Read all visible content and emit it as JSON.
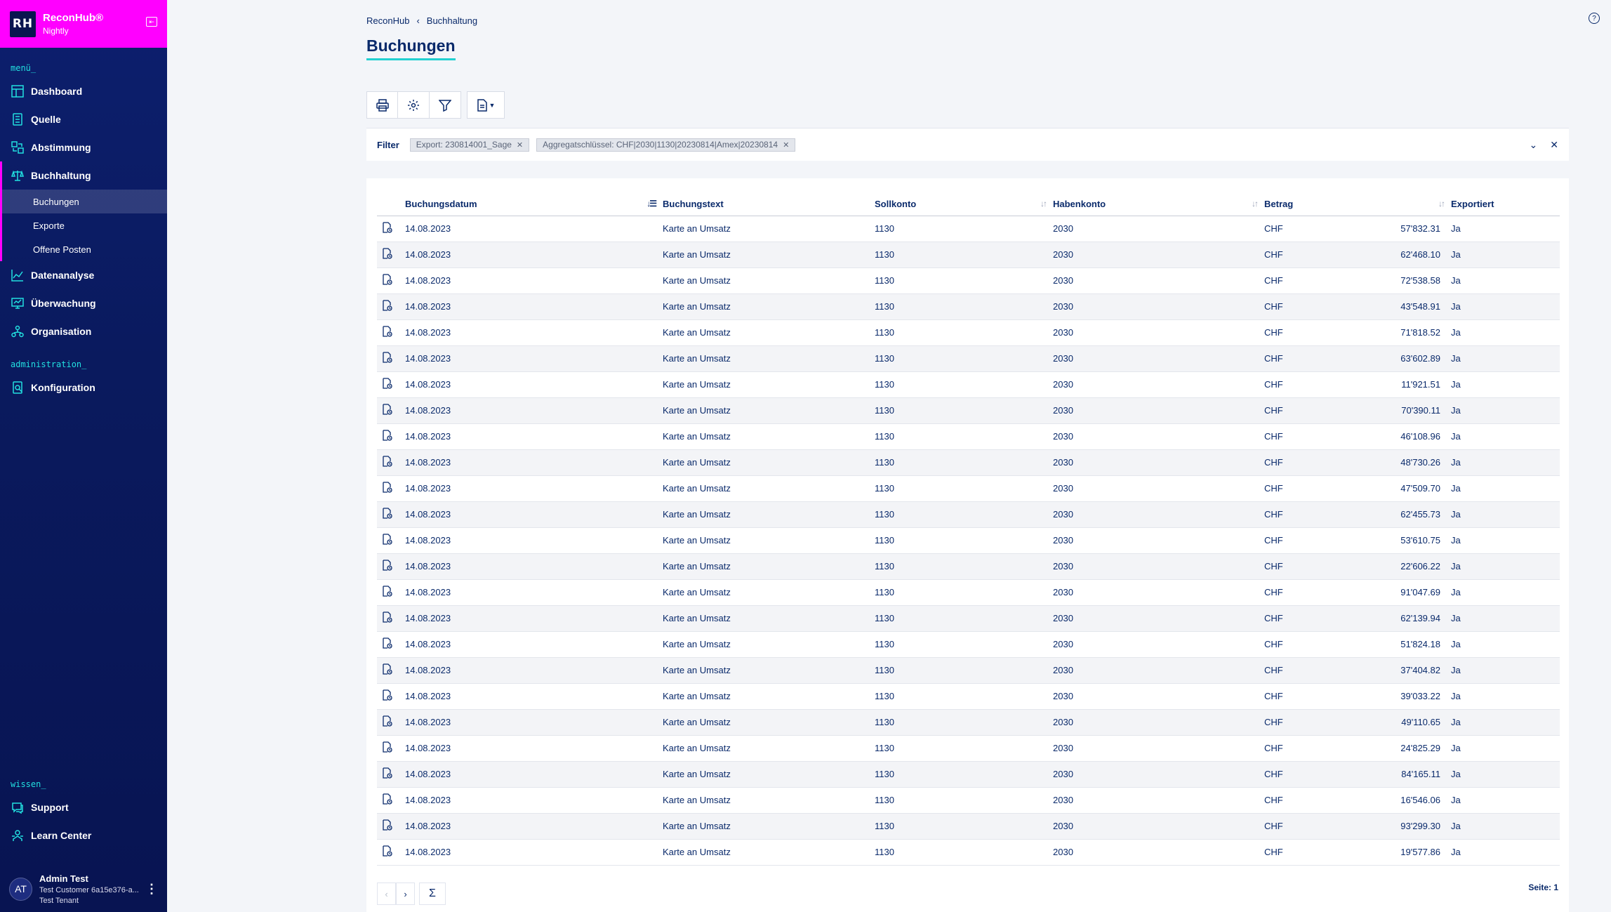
{
  "brand": {
    "logo": "RH",
    "name": "ReconHub®",
    "sub": "Nightly"
  },
  "sidebar": {
    "menu_label": "menü_",
    "items": [
      {
        "label": "Dashboard",
        "icon": "dashboard-icon"
      },
      {
        "label": "Quelle",
        "icon": "source-icon"
      },
      {
        "label": "Abstimmung",
        "icon": "reconcile-icon"
      },
      {
        "label": "Buchhaltung",
        "icon": "scale-icon"
      }
    ],
    "sub_items": [
      {
        "label": "Buchungen"
      },
      {
        "label": "Exporte"
      },
      {
        "label": "Offene Posten"
      }
    ],
    "items2": [
      {
        "label": "Datenanalyse",
        "icon": "chart-icon"
      },
      {
        "label": "Überwachung",
        "icon": "monitor-icon"
      },
      {
        "label": "Organisation",
        "icon": "org-icon"
      }
    ],
    "admin_label": "administration_",
    "admin_items": [
      {
        "label": "Konfiguration",
        "icon": "config-icon"
      }
    ],
    "wissen_label": "wissen_",
    "wissen_items": [
      {
        "label": "Support",
        "icon": "support-icon"
      },
      {
        "label": "Learn Center",
        "icon": "learn-icon"
      }
    ]
  },
  "user": {
    "initials": "AT",
    "name": "Admin Test",
    "customer": "Test Customer 6a15e376-a...",
    "tenant": "Test Tenant"
  },
  "header": {
    "breadcrumb_root": "ReconHub",
    "breadcrumb_current": "Buchhaltung",
    "title": "Buchungen"
  },
  "filter": {
    "label": "Filter",
    "chips": [
      "Export: 230814001_Sage",
      "Aggregatschlüssel: CHF|2030|1130|20230814|Amex|20230814"
    ]
  },
  "table": {
    "columns": [
      "Buchungsdatum",
      "Buchungstext",
      "Sollkonto",
      "Habenkonto",
      "Betrag",
      "Exportiert"
    ],
    "rows": [
      [
        "14.08.2023",
        "Karte an Umsatz",
        "1130",
        "2030",
        "CHF",
        "57'832.31",
        "Ja"
      ],
      [
        "14.08.2023",
        "Karte an Umsatz",
        "1130",
        "2030",
        "CHF",
        "62'468.10",
        "Ja"
      ],
      [
        "14.08.2023",
        "Karte an Umsatz",
        "1130",
        "2030",
        "CHF",
        "72'538.58",
        "Ja"
      ],
      [
        "14.08.2023",
        "Karte an Umsatz",
        "1130",
        "2030",
        "CHF",
        "43'548.91",
        "Ja"
      ],
      [
        "14.08.2023",
        "Karte an Umsatz",
        "1130",
        "2030",
        "CHF",
        "71'818.52",
        "Ja"
      ],
      [
        "14.08.2023",
        "Karte an Umsatz",
        "1130",
        "2030",
        "CHF",
        "63'602.89",
        "Ja"
      ],
      [
        "14.08.2023",
        "Karte an Umsatz",
        "1130",
        "2030",
        "CHF",
        "11'921.51",
        "Ja"
      ],
      [
        "14.08.2023",
        "Karte an Umsatz",
        "1130",
        "2030",
        "CHF",
        "70'390.11",
        "Ja"
      ],
      [
        "14.08.2023",
        "Karte an Umsatz",
        "1130",
        "2030",
        "CHF",
        "46'108.96",
        "Ja"
      ],
      [
        "14.08.2023",
        "Karte an Umsatz",
        "1130",
        "2030",
        "CHF",
        "48'730.26",
        "Ja"
      ],
      [
        "14.08.2023",
        "Karte an Umsatz",
        "1130",
        "2030",
        "CHF",
        "47'509.70",
        "Ja"
      ],
      [
        "14.08.2023",
        "Karte an Umsatz",
        "1130",
        "2030",
        "CHF",
        "62'455.73",
        "Ja"
      ],
      [
        "14.08.2023",
        "Karte an Umsatz",
        "1130",
        "2030",
        "CHF",
        "53'610.75",
        "Ja"
      ],
      [
        "14.08.2023",
        "Karte an Umsatz",
        "1130",
        "2030",
        "CHF",
        "22'606.22",
        "Ja"
      ],
      [
        "14.08.2023",
        "Karte an Umsatz",
        "1130",
        "2030",
        "CHF",
        "91'047.69",
        "Ja"
      ],
      [
        "14.08.2023",
        "Karte an Umsatz",
        "1130",
        "2030",
        "CHF",
        "62'139.94",
        "Ja"
      ],
      [
        "14.08.2023",
        "Karte an Umsatz",
        "1130",
        "2030",
        "CHF",
        "51'824.18",
        "Ja"
      ],
      [
        "14.08.2023",
        "Karte an Umsatz",
        "1130",
        "2030",
        "CHF",
        "37'404.82",
        "Ja"
      ],
      [
        "14.08.2023",
        "Karte an Umsatz",
        "1130",
        "2030",
        "CHF",
        "39'033.22",
        "Ja"
      ],
      [
        "14.08.2023",
        "Karte an Umsatz",
        "1130",
        "2030",
        "CHF",
        "49'110.65",
        "Ja"
      ],
      [
        "14.08.2023",
        "Karte an Umsatz",
        "1130",
        "2030",
        "CHF",
        "24'825.29",
        "Ja"
      ],
      [
        "14.08.2023",
        "Karte an Umsatz",
        "1130",
        "2030",
        "CHF",
        "84'165.11",
        "Ja"
      ],
      [
        "14.08.2023",
        "Karte an Umsatz",
        "1130",
        "2030",
        "CHF",
        "16'546.06",
        "Ja"
      ],
      [
        "14.08.2023",
        "Karte an Umsatz",
        "1130",
        "2030",
        "CHF",
        "93'299.30",
        "Ja"
      ],
      [
        "14.08.2023",
        "Karte an Umsatz",
        "1130",
        "2030",
        "CHF",
        "19'577.86",
        "Ja"
      ]
    ]
  },
  "pager": {
    "prev": "‹",
    "next": "›",
    "sigma": "Σ",
    "page_info": "Seite: 1"
  },
  "colors": {
    "brand": "#ff00ff",
    "accent": "#22e0e0",
    "sidebar": "#0a1a5e",
    "text": "#0a2a6b"
  }
}
